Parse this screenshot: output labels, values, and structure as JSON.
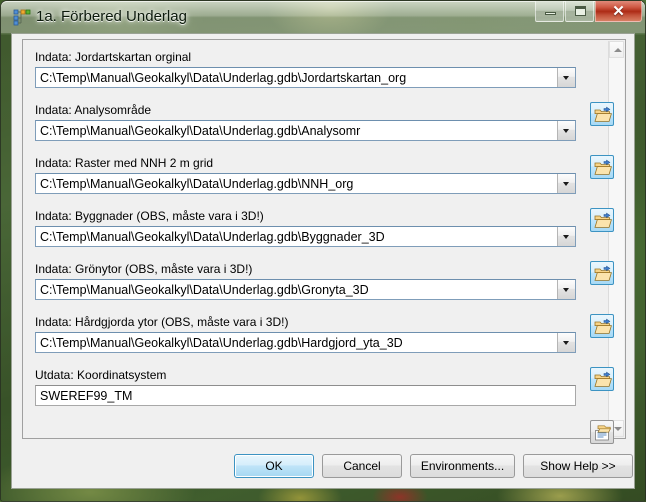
{
  "window": {
    "title": "1a. Förbered Underlag",
    "icon": "arcgis-script-tool-icon",
    "controls": {
      "minimize": "minimize-button",
      "maximize": "maximize-button",
      "close_glyph": "✕"
    },
    "accent_blue": "#3c93c2",
    "close_red": "#ad2b16"
  },
  "parameters": [
    {
      "label": "Indata: Jordartskartan orginal",
      "value": "C:\\Temp\\Manual\\Geokalkyl\\Data\\Underlag.gdb\\Jordartskartan_org",
      "has_dropdown": true,
      "browse_icon": "open-folder-icon"
    },
    {
      "label": "Indata: Analysområde",
      "value": "C:\\Temp\\Manual\\Geokalkyl\\Data\\Underlag.gdb\\Analysomr",
      "has_dropdown": true,
      "browse_icon": "open-folder-icon"
    },
    {
      "label": "Indata: Raster med NNH 2 m grid",
      "value": "C:\\Temp\\Manual\\Geokalkyl\\Data\\Underlag.gdb\\NNH_org",
      "has_dropdown": true,
      "browse_icon": "open-folder-icon"
    },
    {
      "label": "Indata: Byggnader (OBS, måste vara i 3D!)",
      "value": "C:\\Temp\\Manual\\Geokalkyl\\Data\\Underlag.gdb\\Byggnader_3D",
      "has_dropdown": true,
      "browse_icon": "open-folder-icon"
    },
    {
      "label": "Indata: Grönytor (OBS, måste vara i 3D!)",
      "value": "C:\\Temp\\Manual\\Geokalkyl\\Data\\Underlag.gdb\\Gronyta_3D",
      "has_dropdown": true,
      "browse_icon": "open-folder-icon"
    },
    {
      "label": "Indata: Hårdgjorda ytor (OBS, måste vara i 3D!)",
      "value": "C:\\Temp\\Manual\\Geokalkyl\\Data\\Underlag.gdb\\Hardgjord_yta_3D",
      "has_dropdown": true,
      "browse_icon": "open-folder-icon"
    },
    {
      "label": "Utdata: Koordinatsystem",
      "value": "SWEREF99_TM",
      "has_dropdown": false,
      "browse_icon": "spatial-reference-properties-icon"
    }
  ],
  "scrollbar": {
    "up_arrow": "scroll-up-arrow",
    "down_arrow": "scroll-down-arrow"
  },
  "buttons": {
    "ok": "OK",
    "cancel": "Cancel",
    "environments": "Environments...",
    "show_help": "Show Help >>"
  }
}
